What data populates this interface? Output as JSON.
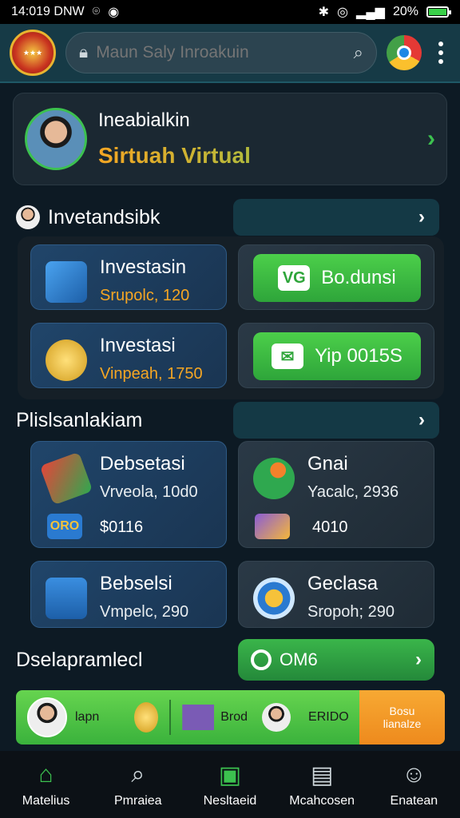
{
  "status": {
    "time": "14:019 DNW",
    "battery": "20%"
  },
  "header": {
    "search_placeholder": "Maun Saly Inroakuin"
  },
  "profile": {
    "name": "Ineabialkin",
    "subtitle": "Sirtuah Virtual"
  },
  "section1": {
    "title": "Invetandsibk",
    "cards": [
      {
        "label": "Investasin",
        "sub": "Srupolc, 120"
      },
      {
        "label": "Investasi",
        "sub": "Vinpeah, 1750"
      }
    ],
    "buttons": [
      {
        "label": "Bo.dunsi",
        "icon": "vg-icon"
      },
      {
        "label": "Yip 0015S",
        "icon": "wallet-icon"
      }
    ]
  },
  "section2": {
    "title": "Plislsanlakiam",
    "cards": [
      {
        "label": "Debsetasi",
        "sub": "Vrveola, 10d0",
        "badge": "ORO",
        "value": "$0116"
      },
      {
        "label": "Gnai",
        "sub": "Yacalc, 2936",
        "value": "4010"
      },
      {
        "label": "Bebselsi",
        "sub": "Vmpelc, 290"
      },
      {
        "label": "Geclasa",
        "sub": "Sropoh; 290"
      }
    ]
  },
  "section3": {
    "title": "Dselapramlecl",
    "button_label": "OM6"
  },
  "promo": {
    "text1": "lapn",
    "text2": "Brod",
    "text3": "ERIDO",
    "orange_line1": "Bosu",
    "orange_line2": "lianalze"
  },
  "nav": [
    {
      "label": "Matelius",
      "icon": "home-icon"
    },
    {
      "label": "Pmraiea",
      "icon": "search-icon"
    },
    {
      "label": "Nesltaeid",
      "icon": "ticket-icon"
    },
    {
      "label": "Mcahcosen",
      "icon": "box-icon"
    },
    {
      "label": "Enatean",
      "icon": "profile-icon"
    }
  ]
}
